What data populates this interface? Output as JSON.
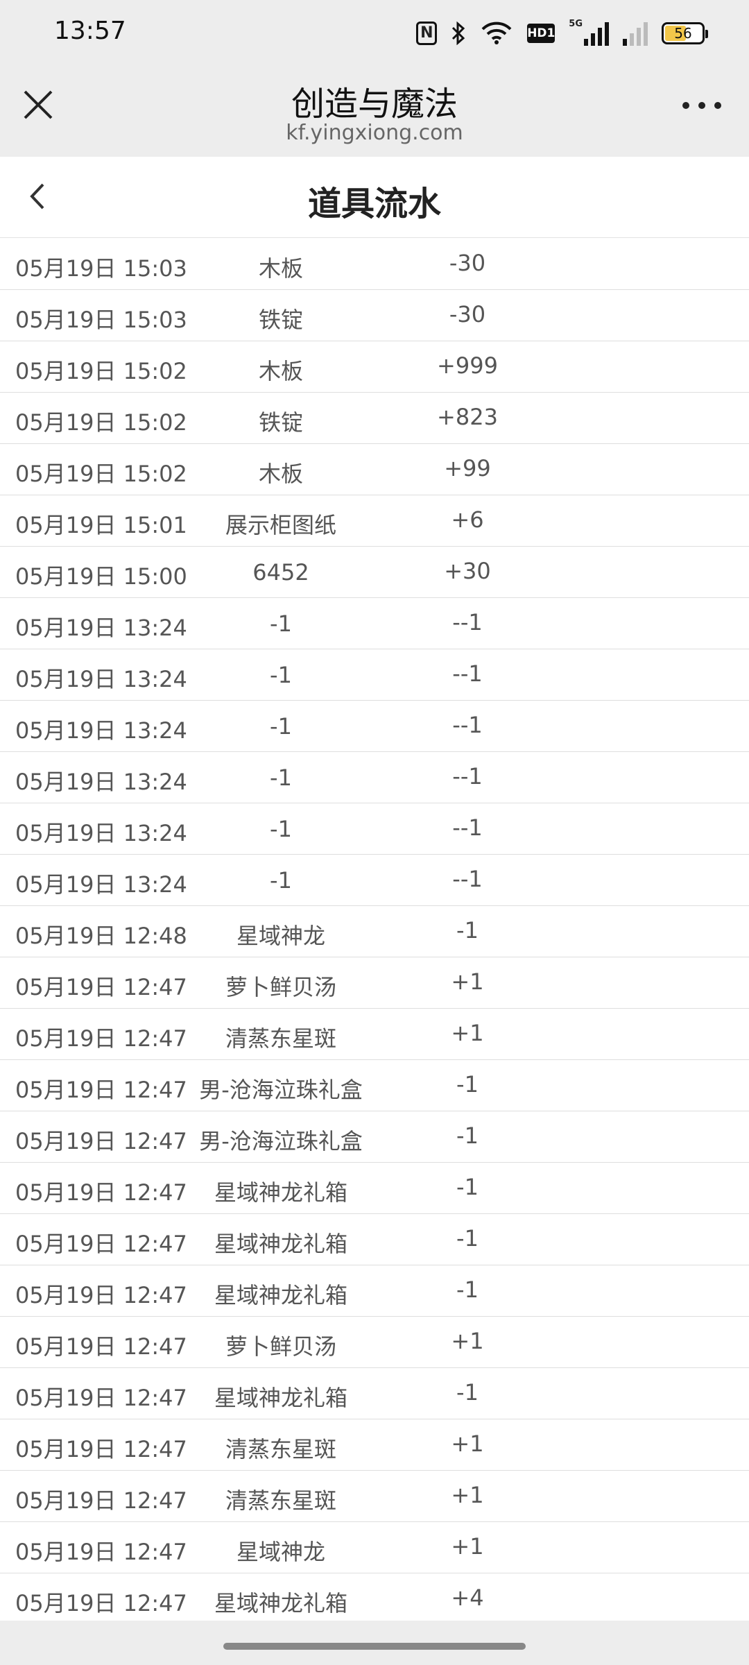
{
  "status_bar": {
    "time": "13:57",
    "icons": [
      "nfc-icon",
      "bluetooth-icon",
      "wifi-icon",
      "hd-icon",
      "signal-5g-icon",
      "signal-icon",
      "battery-icon"
    ],
    "hd_label": "HD1",
    "network_label": "5G",
    "battery_level": "56"
  },
  "title_bar": {
    "title": "创造与魔法",
    "url": "kf.yingxiong.com"
  },
  "page_header": {
    "title": "道具流水"
  },
  "records": [
    {
      "time": "05月19日 15:03",
      "item": "木板",
      "delta": "-30"
    },
    {
      "time": "05月19日 15:03",
      "item": "铁锭",
      "delta": "-30"
    },
    {
      "time": "05月19日 15:02",
      "item": "木板",
      "delta": "+999"
    },
    {
      "time": "05月19日 15:02",
      "item": "铁锭",
      "delta": "+823"
    },
    {
      "time": "05月19日 15:02",
      "item": "木板",
      "delta": "+99"
    },
    {
      "time": "05月19日 15:01",
      "item": "展示柜图纸",
      "delta": "+6"
    },
    {
      "time": "05月19日 15:00",
      "item": "6452",
      "delta": "+30"
    },
    {
      "time": "05月19日 13:24",
      "item": "-1",
      "delta": "--1"
    },
    {
      "time": "05月19日 13:24",
      "item": "-1",
      "delta": "--1"
    },
    {
      "time": "05月19日 13:24",
      "item": "-1",
      "delta": "--1"
    },
    {
      "time": "05月19日 13:24",
      "item": "-1",
      "delta": "--1"
    },
    {
      "time": "05月19日 13:24",
      "item": "-1",
      "delta": "--1"
    },
    {
      "time": "05月19日 13:24",
      "item": "-1",
      "delta": "--1"
    },
    {
      "time": "05月19日 12:48",
      "item": "星域神龙",
      "delta": "-1"
    },
    {
      "time": "05月19日 12:47",
      "item": "萝卜鲜贝汤",
      "delta": "+1"
    },
    {
      "time": "05月19日 12:47",
      "item": "清蒸东星斑",
      "delta": "+1"
    },
    {
      "time": "05月19日 12:47",
      "item": "男-沧海泣珠礼盒",
      "delta": "-1"
    },
    {
      "time": "05月19日 12:47",
      "item": "男-沧海泣珠礼盒",
      "delta": "-1"
    },
    {
      "time": "05月19日 12:47",
      "item": "星域神龙礼箱",
      "delta": "-1"
    },
    {
      "time": "05月19日 12:47",
      "item": "星域神龙礼箱",
      "delta": "-1"
    },
    {
      "time": "05月19日 12:47",
      "item": "星域神龙礼箱",
      "delta": "-1"
    },
    {
      "time": "05月19日 12:47",
      "item": "萝卜鲜贝汤",
      "delta": "+1"
    },
    {
      "time": "05月19日 12:47",
      "item": "星域神龙礼箱",
      "delta": "-1"
    },
    {
      "time": "05月19日 12:47",
      "item": "清蒸东星斑",
      "delta": "+1"
    },
    {
      "time": "05月19日 12:47",
      "item": "清蒸东星斑",
      "delta": "+1"
    },
    {
      "time": "05月19日 12:47",
      "item": "星域神龙",
      "delta": "+1"
    },
    {
      "time": "05月19日 12:47",
      "item": "星域神龙礼箱",
      "delta": "+4"
    }
  ]
}
